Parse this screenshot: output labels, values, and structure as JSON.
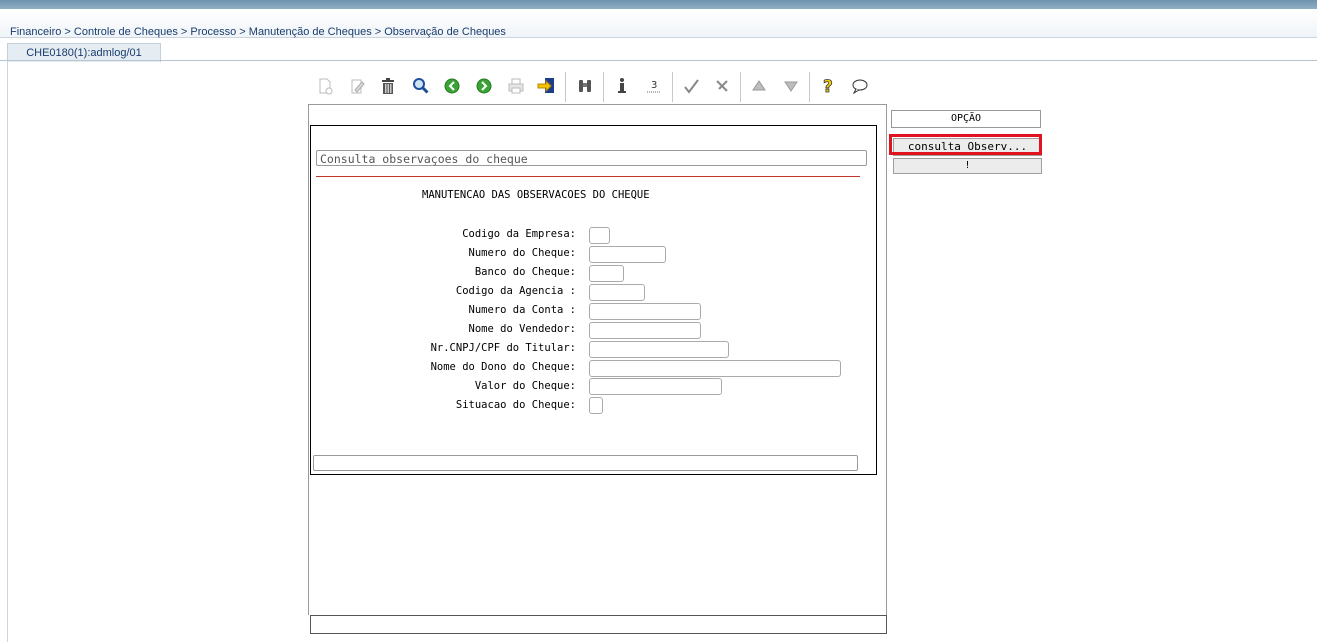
{
  "breadcrumb": "Financeiro > Controle de Cheques > Processo > Manutenção de Cheques > Observação de Cheques",
  "tab": {
    "label": "CHE0180(1):admlog/01"
  },
  "toolbar": {
    "icons": [
      "new-icon",
      "edit-icon",
      "delete-icon",
      "search-icon",
      "previous-icon",
      "next-icon",
      "print-icon",
      "exit-icon",
      "binoculars-icon",
      "info-icon",
      "sum-icon",
      "confirm-icon",
      "cancel-icon",
      "up-icon",
      "down-icon",
      "help-icon",
      "message-icon"
    ]
  },
  "form": {
    "title_field": "Consulta observaçoes do cheque",
    "heading": "MANUTENCAO DAS OBSERVACOES DO CHEQUE",
    "fields": [
      {
        "label": "Codigo da Empresa:",
        "value": ""
      },
      {
        "label": "Numero do Cheque:",
        "value": ""
      },
      {
        "label": "Banco do Cheque:",
        "value": ""
      },
      {
        "label": "Codigo da Agencia :",
        "value": ""
      },
      {
        "label": "Numero da Conta :",
        "value": ""
      },
      {
        "label": "Nome do Vendedor:",
        "value": ""
      },
      {
        "label": "Nr.CNPJ/CPF do Titular:",
        "value": ""
      },
      {
        "label": "Nome do Dono do Cheque:",
        "value": ""
      },
      {
        "label": "Valor do Cheque:",
        "value": ""
      },
      {
        "label": "Situacao do Cheque:",
        "value": ""
      }
    ]
  },
  "options": {
    "header": "OPÇÃO",
    "buttons": [
      "consulta_Observ...",
      "!"
    ]
  },
  "colors": {
    "highlight": "#e0141e",
    "divider": "#c0392b",
    "link": "#1a3d6e"
  }
}
